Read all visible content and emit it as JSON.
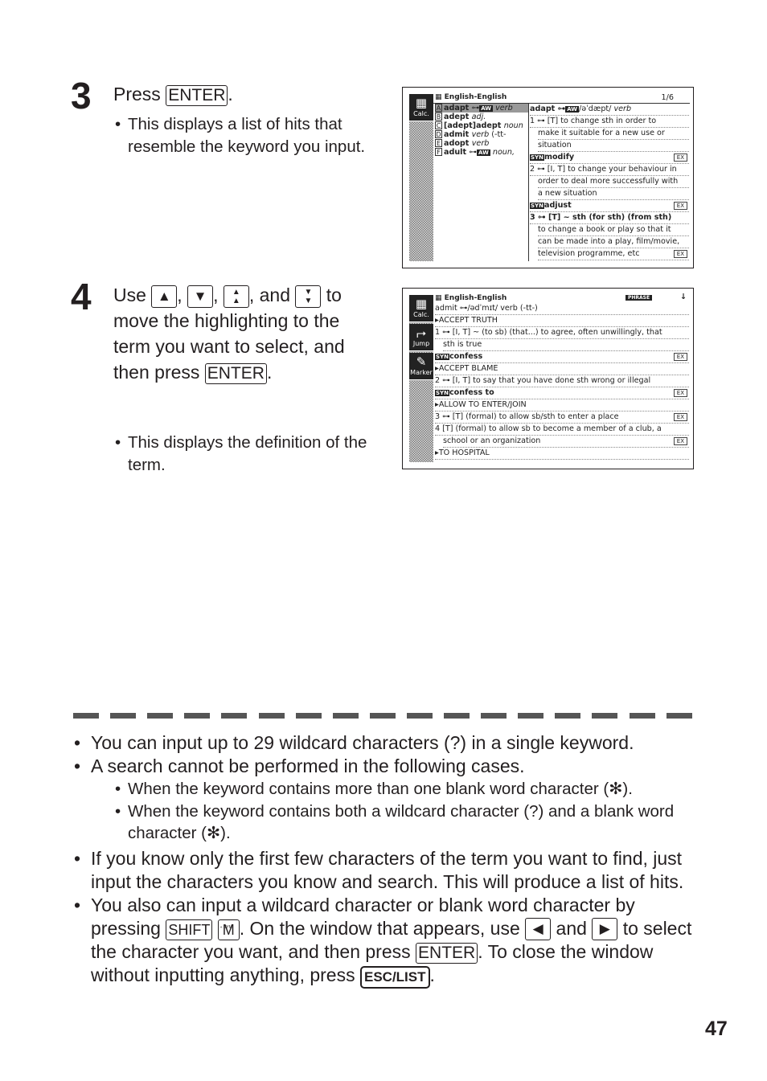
{
  "step3": {
    "number": "3",
    "press": "Press",
    "key": "ENTER",
    "bullet": "This displays a list of hits that resemble the keyword you input."
  },
  "step4": {
    "number": "4",
    "use": "Use",
    "keys": [
      "▲",
      "▼",
      "⏶⏶",
      "⏷⏷"
    ],
    "and": "and",
    "text": "to move the highlighting to the term you want to select, and then press",
    "key": "ENTER",
    "bullet": "This displays the definition of the term."
  },
  "screen1": {
    "title": "English-English",
    "page": "1/6",
    "side": [
      {
        "label": "Calc.",
        "icon": "calculator-icon"
      }
    ],
    "list": [
      {
        "letter": "A",
        "word": "adapt",
        "tag": "AW",
        "pos": "verb",
        "selected": true
      },
      {
        "letter": "B",
        "word": "adept",
        "pos": "adj."
      },
      {
        "letter": "C",
        "word": "[adept]adept",
        "pos": "noun"
      },
      {
        "letter": "D",
        "word": "admit",
        "pos": "verb",
        "extra": "(-tt-"
      },
      {
        "letter": "E",
        "word": "adopt",
        "pos": "verb"
      },
      {
        "letter": "F",
        "word": "adult",
        "tag": "AW",
        "pos": "noun,"
      }
    ],
    "head": {
      "word": "adapt",
      "tag": "AW",
      "pron": "/əˈdæpt/",
      "pos": "verb"
    },
    "lines": [
      {
        "text": "1 ⊶ [T] to change sth in order to"
      },
      {
        "text": "make it suitable for a new use or",
        "indent": true
      },
      {
        "text": "situation",
        "indent": true
      },
      {
        "syn": "SYN",
        "text": "modify",
        "ex": "EX"
      },
      {
        "text": "2 ⊶ [I, T] to change your behaviour in"
      },
      {
        "text": "order to deal more successfully with",
        "indent": true
      },
      {
        "text": "a new situation",
        "indent": true
      },
      {
        "syn": "SYN",
        "text": "adjust",
        "ex": "EX"
      },
      {
        "text": "3 ⊶ [T] ~ sth (for sth) (from sth)",
        "bold": true
      },
      {
        "text": "to change a book or play so that it",
        "indent": true
      },
      {
        "text": "can be made into a play, film/movie,",
        "indent": true
      },
      {
        "text": "television programme, etc",
        "indent": true,
        "ex": "EX"
      }
    ]
  },
  "screen2": {
    "title": "English-English",
    "badge": "PHRASE",
    "arrow": "↓",
    "side": [
      {
        "label": "Calc.",
        "icon": "calculator-icon"
      },
      {
        "label": "Jump",
        "icon": "jump-icon"
      },
      {
        "label": "Marker",
        "icon": "marker-icon"
      }
    ],
    "lines": [
      {
        "text": "admit ⊶/ədˈmɪt/ verb (-tt-)"
      },
      {
        "text": "▸ACCEPT TRUTH"
      },
      {
        "text": "1 ⊶ [I, T] ~ (to sb) (that...) to agree, often unwillingly, that"
      },
      {
        "text": "sth is true",
        "indent": true
      },
      {
        "syn": "SYN",
        "text": "confess",
        "ex": "EX"
      },
      {
        "text": "▸ACCEPT BLAME"
      },
      {
        "text": "2 ⊶ [I, T] to say that you have done sth wrong or illegal"
      },
      {
        "syn": "SYN",
        "text": "confess to",
        "ex": "EX"
      },
      {
        "text": "▸ALLOW TO ENTER/JOIN"
      },
      {
        "text": "3 ⊶ [T] (formal) to allow sb/sth to enter a place",
        "ex": "EX"
      },
      {
        "text": "4 [T] (formal) to allow sb to become a member of a club, a"
      },
      {
        "text": "school or an organization",
        "indent": true,
        "ex": "EX"
      },
      {
        "text": "▸TO HOSPITAL"
      }
    ]
  },
  "notes": {
    "n1": "You can input up to 29 wildcard characters (?) in a single keyword.",
    "n2": "A search cannot be performed in the following cases.",
    "n2a": "When the keyword contains more than one blank word character (✻).",
    "n2b": "When the keyword contains both a wildcard character (?) and a blank word character (✻).",
    "n3": "If you know only the first few characters of the term you want to find, just input the characters you know and search. This will produce a list of hits.",
    "n4a": "You also can input a wildcard character or blank word character by pressing",
    "key_shift": "SHIFT",
    "key_m": "M",
    "key_m_sup": "÷ SYM",
    "n4b": ". On the window that appears, use",
    "key_left": "◀",
    "and": "and",
    "key_right": "▶",
    "n4c": "to select the character you want, and then press",
    "key_enter": "ENTER",
    "n4d": ". To close the window without inputting anything, press",
    "key_esc": "ESC/LIST",
    "n4e": "."
  },
  "page_number": "47"
}
